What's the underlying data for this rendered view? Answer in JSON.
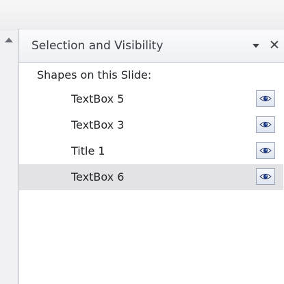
{
  "panel": {
    "title": "Selection and Visibility",
    "close_glyph": "✕",
    "section_label": "Shapes on this Slide:"
  },
  "shapes": [
    {
      "name": "TextBox 5",
      "visible": true,
      "selected": false
    },
    {
      "name": "TextBox 3",
      "visible": true,
      "selected": false
    },
    {
      "name": "Title 1",
      "visible": true,
      "selected": false
    },
    {
      "name": "TextBox 6",
      "visible": true,
      "selected": true
    }
  ],
  "icons": {
    "scroll_up": "scroll-up-arrow-icon",
    "dropdown": "dropdown-triangle-icon",
    "close": "close-icon",
    "visibility": "eye-icon"
  },
  "colors": {
    "selected_row": "#e3e3e6",
    "eye_pupil": "#1a3a86"
  }
}
